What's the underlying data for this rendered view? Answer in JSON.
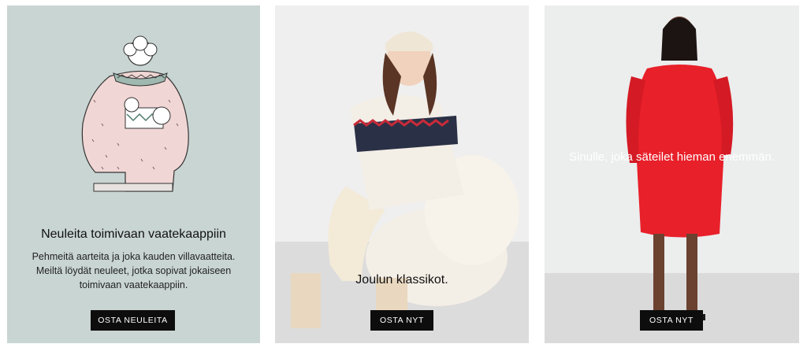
{
  "cards": [
    {
      "heading": "Neuleita toimivaan vaatekaappiin",
      "body": "Pehmeitä aarteita ja joka kauden villavaatteita. Meiltä löydät neuleet, jotka sopivat jokaiseen toimivaan vaatekaappiin.",
      "button": "OSTA NEULEITA"
    },
    {
      "caption": "Joulun klassikot.",
      "button": "OSTA NYT"
    },
    {
      "caption": "Sinulle, joka säteilet hieman enemmän.",
      "button": "OSTA NYT"
    }
  ],
  "colors": {
    "card1_bg": "#c9d5d3",
    "sweater_pink": "#f0d6d4",
    "button_bg": "#0d0d0d",
    "dress_red": "#e8202a"
  }
}
